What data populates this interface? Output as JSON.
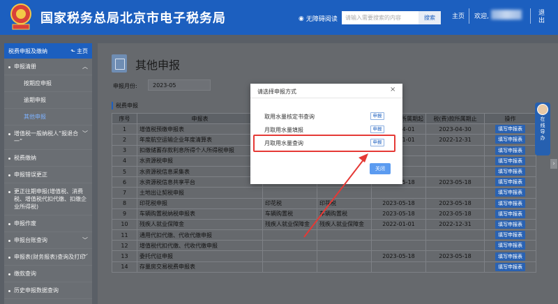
{
  "header": {
    "emblem_text": "税",
    "title": "国家税务总局北京市电子税务局",
    "accessible_label": "无障碍阅读",
    "search_placeholder": "请输入需要搜索的内容",
    "search_button": "搜索",
    "home_link": "主页",
    "welcome": "欢迎,",
    "logout": "退出",
    "accent_color": "#1c5fbf"
  },
  "sidebar": {
    "section_label": "税费申报及缴纳",
    "home_label": "主页",
    "items": [
      {
        "label": "申报清册",
        "expanded": true
      },
      {
        "label": "按期应申报",
        "sub": true
      },
      {
        "label": "逾期申报",
        "sub": true
      },
      {
        "label": "其他申报",
        "sub": true,
        "active": true
      },
      {
        "label": "增值税一般纳税人“报退合一”",
        "chevron": true
      },
      {
        "label": "税费缴纳"
      },
      {
        "label": "申报错误更正"
      },
      {
        "label": "更正往期申报(增值税、消费税、增值税代扣代缴、扣缴企业所得税)"
      },
      {
        "label": "申报作废"
      },
      {
        "label": "申报台账查询",
        "chevron": true
      },
      {
        "label": "申报表(财务报表)查询及打印",
        "chevron": true
      },
      {
        "label": "缴款查询"
      },
      {
        "label": "历史申报数据查询"
      }
    ]
  },
  "main": {
    "page_title": "其他申报",
    "period_label": "申报月份:",
    "period_value": "2023-05",
    "section_title": "税费申报",
    "columns": [
      "序号",
      "申报表",
      "",
      "",
      "款所属期起",
      "税(费)款所属期止",
      "操作"
    ],
    "fill_button": "填写申报表",
    "rows": [
      {
        "no": "1",
        "form": "增值税预缴申报表",
        "c3": "",
        "c4": "",
        "start": "2023-04-01",
        "end": "2023-04-30",
        "op": true
      },
      {
        "no": "2",
        "form": "年度航空运输企业年度清算表",
        "c3": "",
        "c4": "",
        "start": "2022-01-01",
        "end": "2022-12-31",
        "op": true
      },
      {
        "no": "3",
        "form": "扣缴储蓄存款利息所得个人所得税申报",
        "c3": "",
        "c4": "",
        "start": "",
        "end": "",
        "op": true
      },
      {
        "no": "4",
        "form": "水资源税申报",
        "c3": "",
        "c4": "",
        "start": "",
        "end": "",
        "op": true
      },
      {
        "no": "5",
        "form": "水资源税信息采集表",
        "c3": "资源税",
        "c4": "",
        "start": "",
        "end": "",
        "op": true
      },
      {
        "no": "6",
        "form": "水资源税信息共享平台",
        "c3": "",
        "c4": "",
        "start": "2023-05-18",
        "end": "2023-05-18",
        "op": true
      },
      {
        "no": "7",
        "form": "土地出让契税申报",
        "c3": "",
        "c4": "",
        "start": "",
        "end": "",
        "op": true
      },
      {
        "no": "8",
        "form": "印花税申报",
        "c3": "印花税",
        "c4": "印花税",
        "start": "2023-05-18",
        "end": "2023-05-18",
        "op": true
      },
      {
        "no": "9",
        "form": "车辆购置税纳税申报表",
        "c3": "车辆购置税",
        "c4": "车辆购置税",
        "start": "2023-05-18",
        "end": "2023-05-18",
        "op": true
      },
      {
        "no": "10",
        "form": "残疾人就业保障金",
        "c3": "残疾人就业保障金",
        "c4": "残疾人就业保障金",
        "start": "2022-01-01",
        "end": "2022-12-31",
        "op": true
      },
      {
        "no": "11",
        "form": "通用代扣代缴、代收代缴申报",
        "c3": "",
        "c4": "",
        "start": "",
        "end": "",
        "op": true
      },
      {
        "no": "12",
        "form": "增值税代扣代缴、代收代缴申报",
        "c3": "",
        "c4": "",
        "start": "",
        "end": "",
        "op": true
      },
      {
        "no": "13",
        "form": "委托代征申报",
        "c3": "",
        "c4": "",
        "start": "2023-05-18",
        "end": "2023-05-18",
        "op": true
      },
      {
        "no": "14",
        "form": "存量房交易税费申报表",
        "c3": "",
        "c4": "",
        "start": "",
        "end": "",
        "op": true
      }
    ]
  },
  "float_help": {
    "label": "在线导办"
  },
  "modal": {
    "title": "请选择申报方式",
    "options": [
      {
        "label": "取用水量核定书查询",
        "button": "申报"
      },
      {
        "label": "月取用水量填报",
        "button": "申报"
      },
      {
        "label": "月取用水量查询",
        "button": "申报"
      }
    ],
    "close_button": "关闭",
    "highlight_color": "#e53935"
  }
}
